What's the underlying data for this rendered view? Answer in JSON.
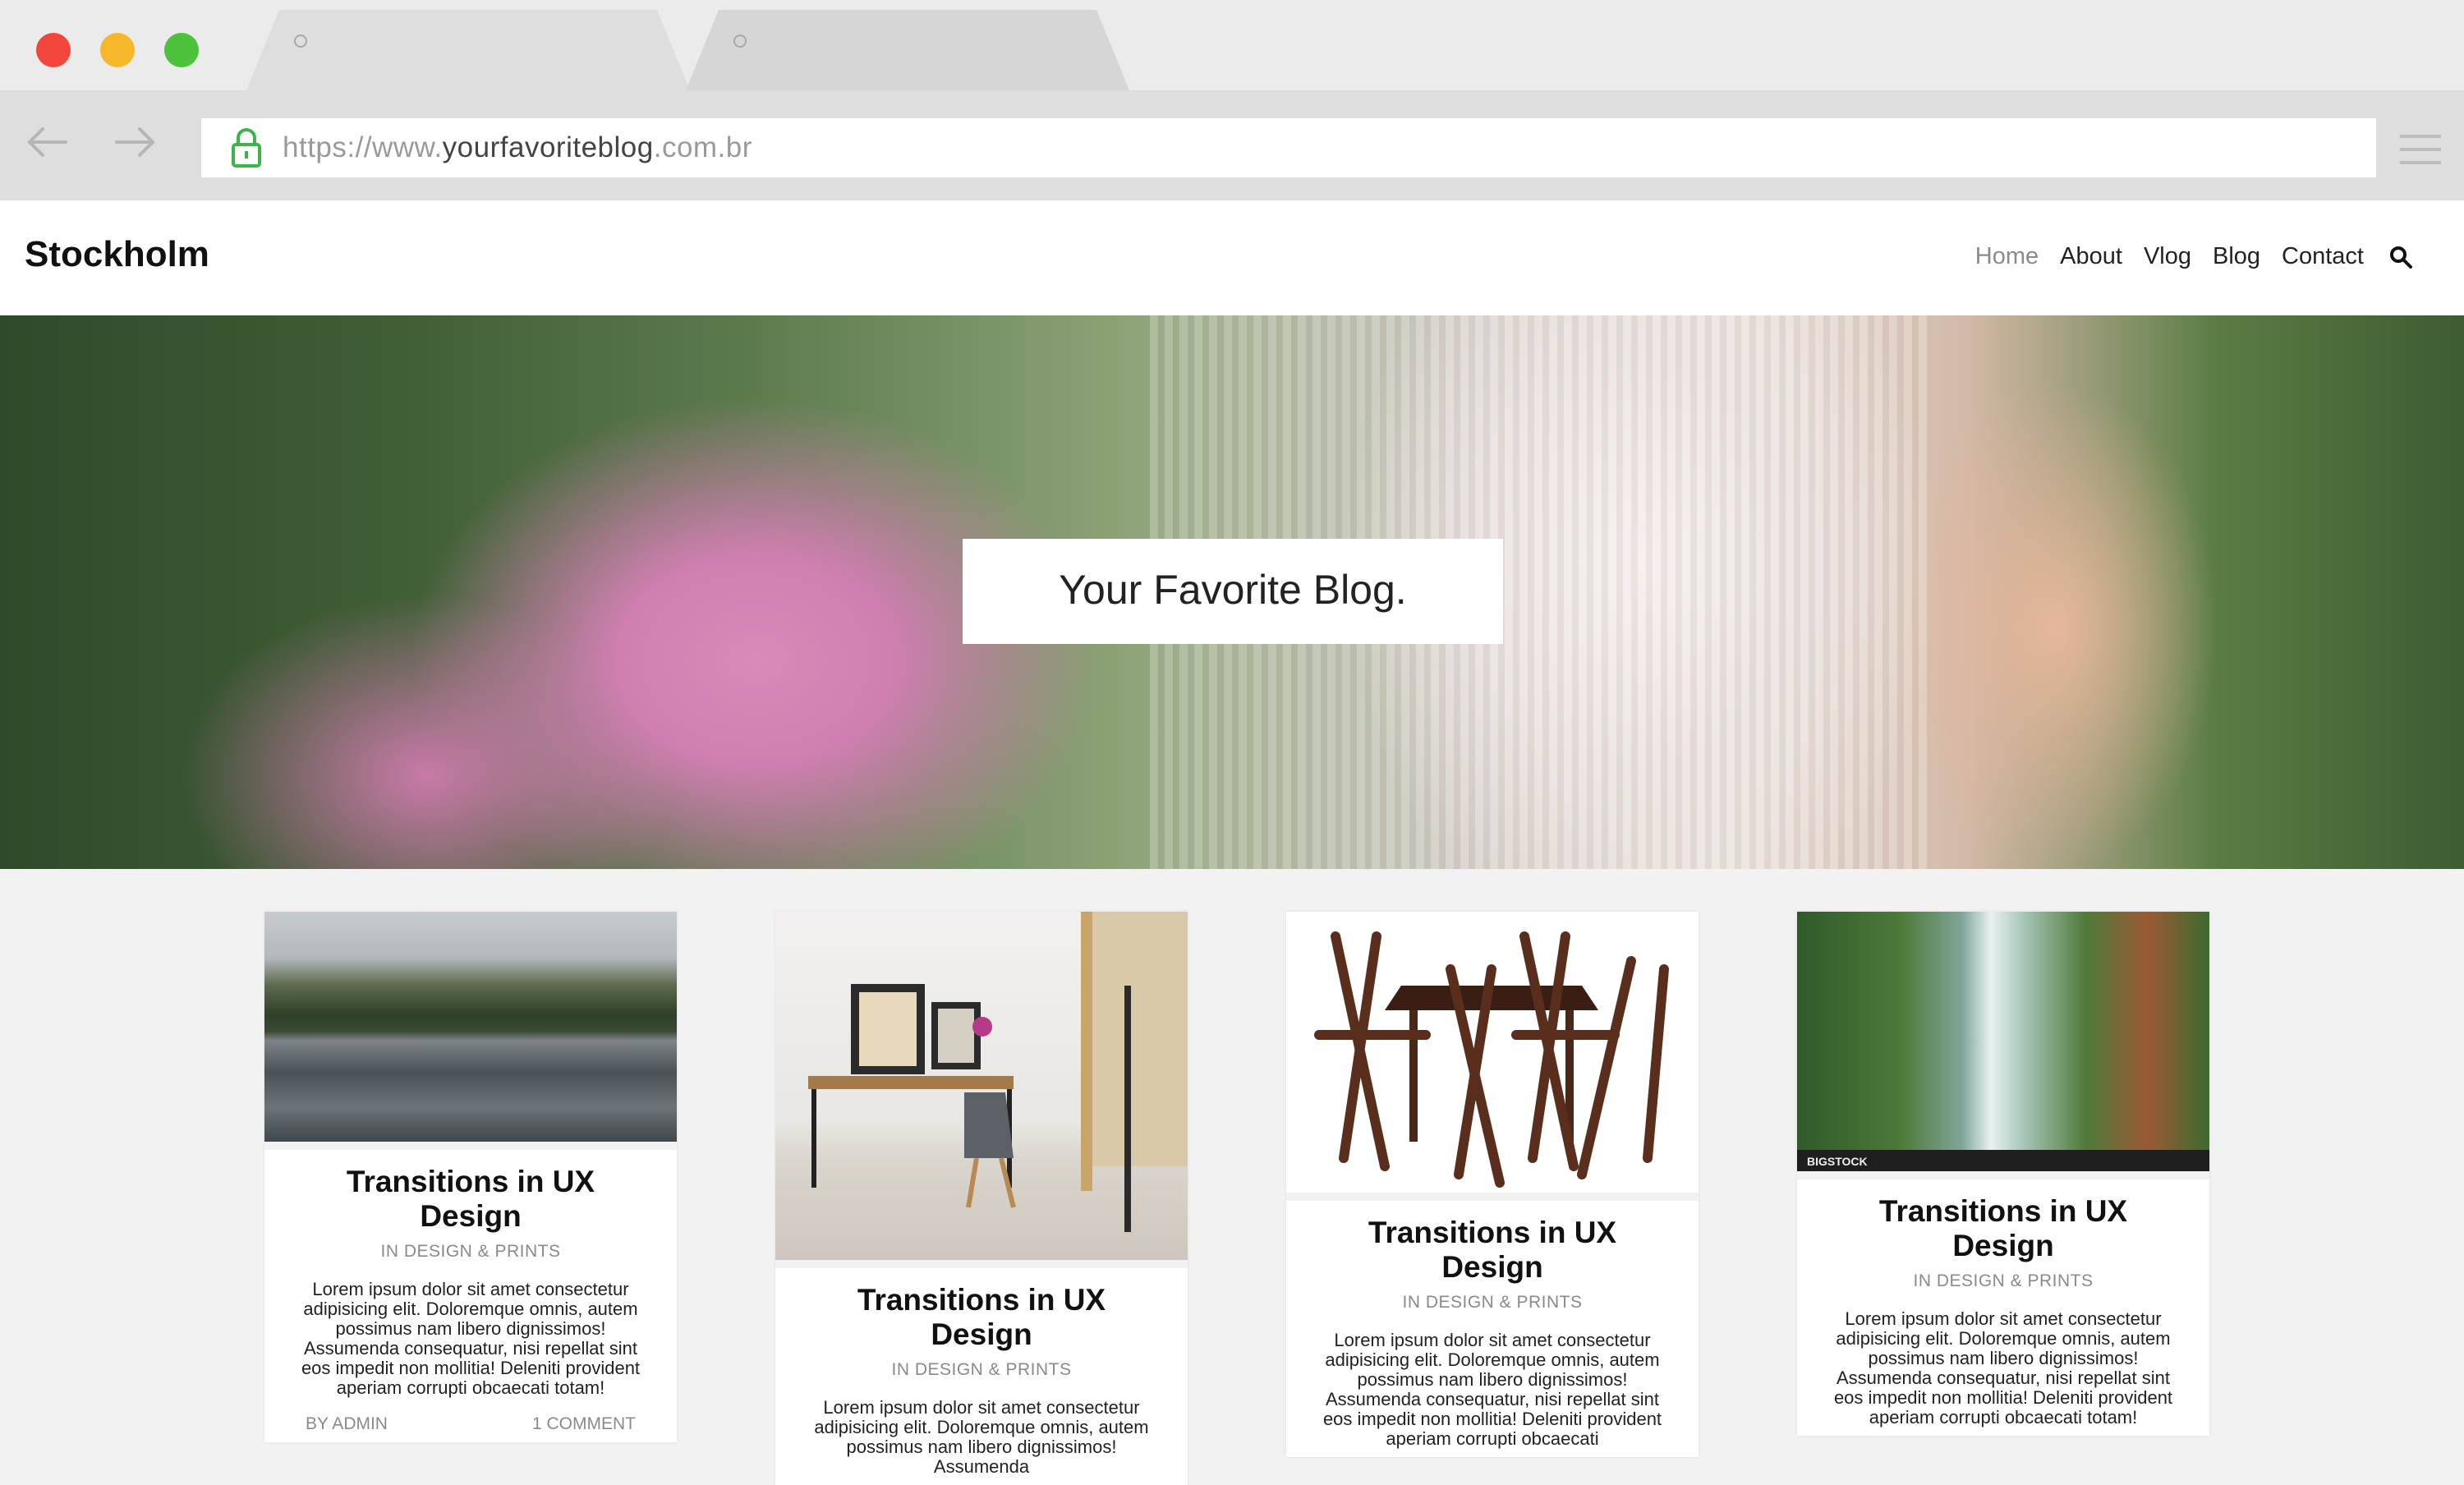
{
  "browser": {
    "url_prefix": "https://www.",
    "url_domain": "yourfavoriteblog",
    "url_suffix": ".com.br"
  },
  "site": {
    "title": "Stockholm",
    "nav": [
      "Home",
      "About",
      "Vlog",
      "Blog",
      "Contact"
    ],
    "active_nav": "Home"
  },
  "hero": {
    "title": "Your Favorite Blog."
  },
  "posts": [
    {
      "title": "Transitions in UX Design",
      "category": "IN DESIGN & PRINTS",
      "excerpt": "Lorem ipsum dolor sit amet consectetur adipisicing elit. Doloremque omnis, autem possimus nam libero dignissimos! Assumenda consequatur, nisi repellat sint eos impedit non mollitia! Deleniti provident aperiam corrupti obcaecati totam!",
      "author": "BY ADMIN",
      "comments": "1 COMMENT"
    },
    {
      "title": "Transitions in UX Design",
      "category": "IN DESIGN & PRINTS",
      "excerpt": "Lorem ipsum dolor sit amet consectetur adipisicing elit. Doloremque omnis, autem possimus nam libero dignissimos! Assumenda"
    },
    {
      "title": "Transitions in UX Design",
      "category": "IN DESIGN & PRINTS",
      "excerpt": "Lorem ipsum dolor sit amet consectetur adipisicing elit. Doloremque omnis, autem possimus nam libero dignissimos! Assumenda consequatur, nisi repellat sint eos impedit non mollitia! Deleniti provident aperiam corrupti obcaecati"
    },
    {
      "title": "Transitions in UX Design",
      "category": "IN DESIGN & PRINTS",
      "excerpt": "Lorem ipsum dolor sit amet consectetur adipisicing elit. Doloremque omnis, autem possimus nam libero dignissimos! Assumenda consequatur, nisi repellat sint eos impedit non mollitia! Deleniti provident aperiam corrupti obcaecati totam!",
      "image_watermark": "BIGSTOCK"
    }
  ],
  "colors": {
    "close": "#f2463c",
    "minimize": "#f5b82a",
    "maximize": "#4cc13a",
    "lock": "#3bb54a"
  }
}
